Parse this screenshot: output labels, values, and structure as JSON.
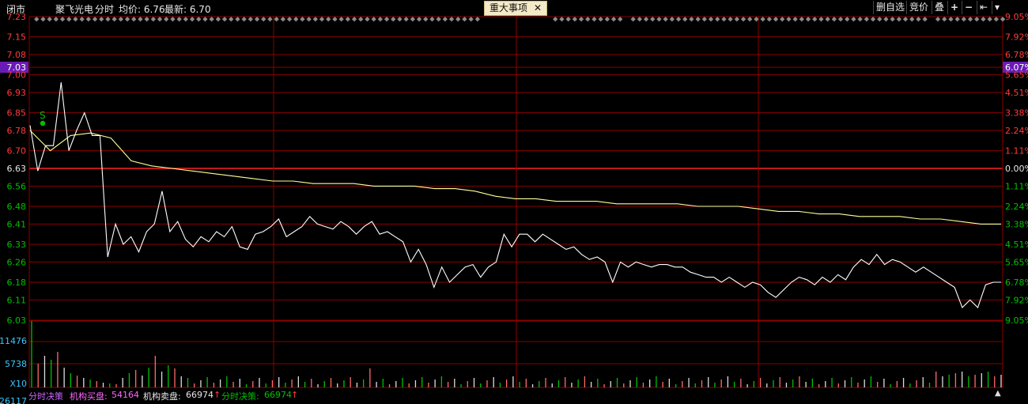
{
  "header": {
    "status": "闭市",
    "stock_name": "聚飞光电",
    "mode": "分时",
    "avg_label": "均价: 6.76",
    "latest_label": "最新: 6.70",
    "event_button": "重大事项",
    "event_close": "✕"
  },
  "toolbar": {
    "delete_watch": "删自选",
    "auction": "竞价",
    "overlay": "叠",
    "zoom_in": "+",
    "zoom_out": "−",
    "first": "⇤",
    "more": "▾"
  },
  "price_axis": {
    "labels": [
      "7.23",
      "7.15",
      "7.08",
      "7.03",
      "7.00",
      "6.93",
      "6.85",
      "6.78",
      "6.70",
      "6.63",
      "6.56",
      "6.48",
      "6.41",
      "6.33",
      "6.26",
      "6.18",
      "6.11",
      "6.03"
    ],
    "highlight": "7.03",
    "prev_close": "6.63"
  },
  "pct_axis": {
    "labels": [
      "9.05%",
      "7.92%",
      "6.78%",
      "6.07%",
      "5.65%",
      "4.51%",
      "3.38%",
      "2.24%",
      "1.11%",
      "0.00%",
      "1.11%",
      "2.24%",
      "3.38%",
      "4.51%",
      "5.65%",
      "6.78%",
      "7.92%",
      "9.05%"
    ]
  },
  "volume_axis": {
    "labels": [
      "11476",
      "5738",
      "X10",
      "26117"
    ]
  },
  "marker": "S",
  "bottom": {
    "tab": "分时决策",
    "inst_buy_label": "机构买盘:",
    "inst_buy_value": "54164",
    "inst_sell_label": "机构卖盘:",
    "inst_sell_value": "66974",
    "arrow": "↑",
    "tab2": "分时决策:",
    "tab2_value": "66974",
    "arrow2": "↑"
  },
  "colors": {
    "grid": "#8b0000",
    "up": "#ff3b3b",
    "down": "#00c000",
    "price_line": "#ffffff",
    "avg_line": "#ffff99",
    "highlight_bg": "#6a1bb5",
    "volume_axis": "#38c8ff"
  },
  "chart_data": {
    "type": "line",
    "ylim": [
      6.03,
      7.23
    ],
    "prev_close": 6.63,
    "series": [
      {
        "values": [
          6.8,
          6.62,
          6.72,
          6.72,
          6.97,
          6.7,
          6.78,
          6.85,
          6.76,
          6.76,
          6.28,
          6.41,
          6.33,
          6.36,
          6.3,
          6.38,
          6.41,
          6.54,
          6.38,
          6.42,
          6.35,
          6.32,
          6.36,
          6.34,
          6.38,
          6.36,
          6.4,
          6.32,
          6.31,
          6.37,
          6.38,
          6.4,
          6.43,
          6.36,
          6.38,
          6.4,
          6.44,
          6.41,
          6.4,
          6.39,
          6.42,
          6.4,
          6.37,
          6.4,
          6.42,
          6.37,
          6.38,
          6.36,
          6.34,
          6.26,
          6.31,
          6.25,
          6.16,
          6.24,
          6.18,
          6.21,
          6.24,
          6.25,
          6.2,
          6.24,
          6.26,
          6.37,
          6.32,
          6.37,
          6.37,
          6.34,
          6.37,
          6.35,
          6.33,
          6.31,
          6.32,
          6.29,
          6.27,
          6.28,
          6.26,
          6.18,
          6.26,
          6.24,
          6.26,
          6.25,
          6.24,
          6.25,
          6.25,
          6.24,
          6.24,
          6.22,
          6.21,
          6.2,
          6.2,
          6.18,
          6.2,
          6.18,
          6.16,
          6.18,
          6.17,
          6.14,
          6.12,
          6.15,
          6.18,
          6.2,
          6.19,
          6.17,
          6.2,
          6.18,
          6.21,
          6.19,
          6.24,
          6.27,
          6.25,
          6.29,
          6.25,
          6.27,
          6.26,
          6.24,
          6.22,
          6.24,
          6.22,
          6.2,
          6.18,
          6.16,
          6.08,
          6.11,
          6.08,
          6.17,
          6.18,
          6.18
        ]
      },
      {
        "values": [
          6.78,
          6.7,
          6.76,
          6.77,
          6.75,
          6.66,
          6.64,
          6.63,
          6.62,
          6.61,
          6.6,
          6.59,
          6.58,
          6.58,
          6.57,
          6.57,
          6.57,
          6.56,
          6.56,
          6.56,
          6.55,
          6.55,
          6.54,
          6.52,
          6.51,
          6.51,
          6.5,
          6.5,
          6.5,
          6.49,
          6.49,
          6.49,
          6.49,
          6.48,
          6.48,
          6.48,
          6.47,
          6.46,
          6.46,
          6.45,
          6.45,
          6.44,
          6.44,
          6.44,
          6.43,
          6.43,
          6.42,
          6.41,
          6.41
        ]
      }
    ]
  }
}
